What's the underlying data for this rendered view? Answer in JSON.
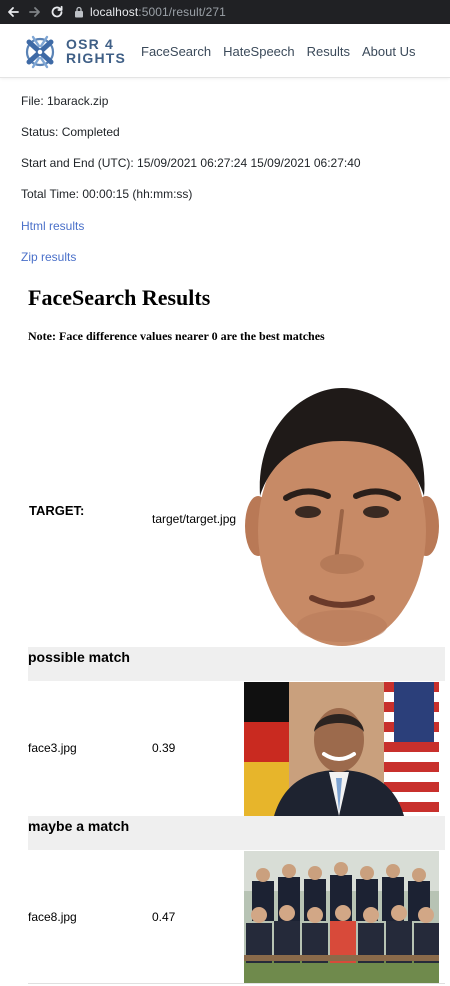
{
  "browser": {
    "url_host": "localhost",
    "url_path": ":5001/result/271"
  },
  "site": {
    "logo_line1": "OSR 4",
    "logo_line2": "RIGHTS",
    "nav": [
      "FaceSearch",
      "HateSpeech",
      "Results",
      "About Us"
    ]
  },
  "info": {
    "file": "File: 1barack.zip",
    "status": "Status: Completed",
    "start_end": "Start and End (UTC): 15/09/2021 06:27:24 15/09/2021 06:27:40",
    "total_time": "Total Time: 00:00:15 (hh:mm:ss)",
    "html_results": "Html results",
    "zip_results": "Zip results"
  },
  "results": {
    "title": "FaceSearch Results",
    "note": "Note: Face difference values nearer 0 are the best matches",
    "target_label": "TARGET:",
    "target_path": "target/target.jpg",
    "groups": [
      {
        "heading": "possible match",
        "file": "face3.jpg",
        "score": "0.39"
      },
      {
        "heading": "maybe a match",
        "file": "face8.jpg",
        "score": "0.47"
      }
    ]
  },
  "colors": {
    "accent_link": "#4a70c9",
    "logo_blue": "#3f5f86",
    "band_gray": "#efefef"
  }
}
